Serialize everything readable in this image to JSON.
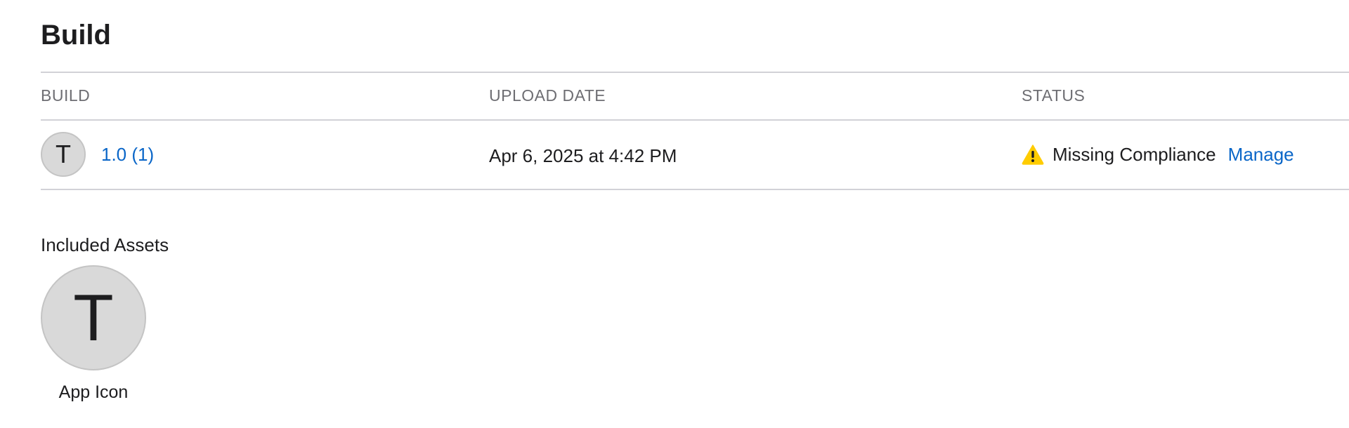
{
  "section": {
    "title": "Build"
  },
  "table": {
    "headers": {
      "build": "BUILD",
      "upload_date": "UPLOAD DATE",
      "status": "STATUS"
    },
    "rows": [
      {
        "avatar_initial": "T",
        "build": "1.0 (1)",
        "upload_date": "Apr 6, 2025 at 4:42 PM",
        "status_icon": "warning-triangle-icon",
        "status": "Missing Compliance",
        "action": "Manage"
      }
    ]
  },
  "assets": {
    "label": "Included Assets",
    "items": [
      {
        "initial": "T",
        "caption": "App Icon"
      }
    ]
  },
  "colors": {
    "link": "#0a66c8",
    "warning": "#ffcc00",
    "divider": "#d2d2d7",
    "header_text": "#6e6e73",
    "avatar_bg": "#d9d9d9"
  }
}
